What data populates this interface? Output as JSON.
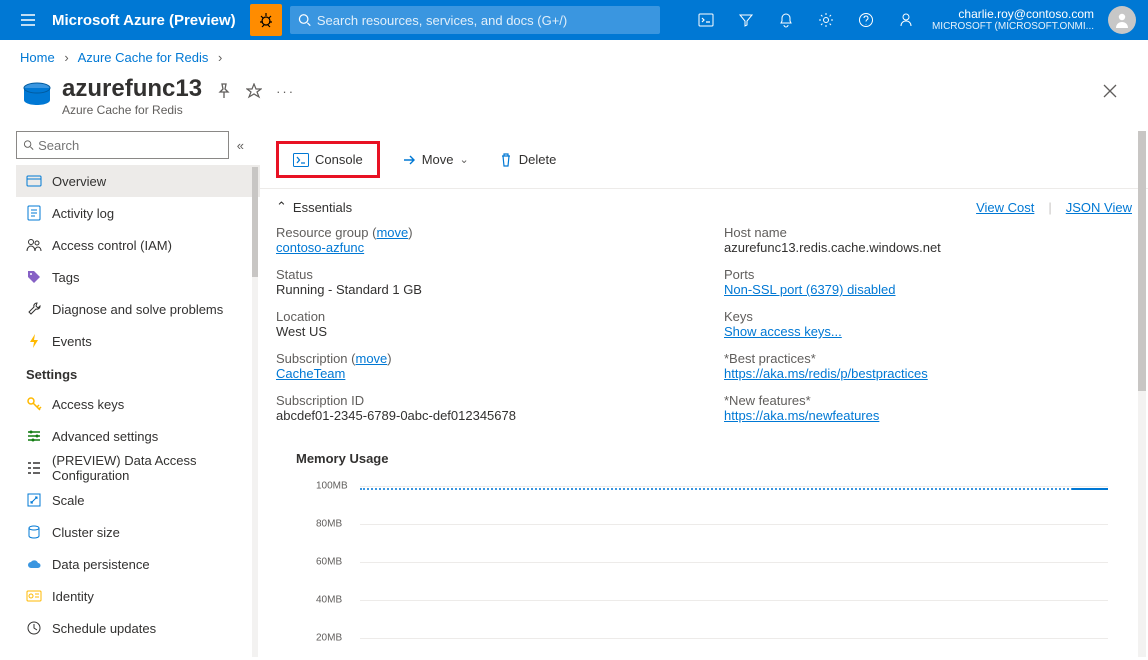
{
  "topbar": {
    "brand": "Microsoft Azure (Preview)",
    "search_placeholder": "Search resources, services, and docs (G+/)",
    "email": "charlie.roy@contoso.com",
    "org": "MICROSOFT (MICROSOFT.ONMI..."
  },
  "breadcrumb": {
    "items": [
      "Home",
      "Azure Cache for Redis"
    ]
  },
  "resource": {
    "name": "azurefunc13",
    "type": "Azure Cache for Redis"
  },
  "sidebar": {
    "search_placeholder": "Search",
    "items": [
      {
        "label": "Overview",
        "icon": "overview",
        "color": "#0078d4",
        "selected": true
      },
      {
        "label": "Activity log",
        "icon": "log",
        "color": "#0078d4"
      },
      {
        "label": "Access control (IAM)",
        "icon": "people",
        "color": "#323130"
      },
      {
        "label": "Tags",
        "icon": "tag",
        "color": "#8661c5"
      },
      {
        "label": "Diagnose and solve problems",
        "icon": "wrench",
        "color": "#323130"
      },
      {
        "label": "Events",
        "icon": "bolt",
        "color": "#ffb900"
      }
    ],
    "section": "Settings",
    "settings": [
      {
        "label": "Access keys",
        "icon": "key",
        "color": "#ffb900"
      },
      {
        "label": "Advanced settings",
        "icon": "sliders",
        "color": "#107c10"
      },
      {
        "label": "(PREVIEW) Data Access Configuration",
        "icon": "list",
        "color": "#323130"
      },
      {
        "label": "Scale",
        "icon": "scale",
        "color": "#0078d4"
      },
      {
        "label": "Cluster size",
        "icon": "cluster",
        "color": "#0078d4"
      },
      {
        "label": "Data persistence",
        "icon": "cloud",
        "color": "#3a96e0"
      },
      {
        "label": "Identity",
        "icon": "id",
        "color": "#ffb900"
      },
      {
        "label": "Schedule updates",
        "icon": "schedule",
        "color": "#323130"
      }
    ]
  },
  "toolbar": {
    "console": "Console",
    "move": "Move",
    "delete": "Delete"
  },
  "essentials": {
    "label": "Essentials",
    "view_cost": "View Cost",
    "json_view": "JSON View",
    "left": [
      {
        "k": "Resource group (",
        "klink": "move",
        "kend": ")",
        "vlink": "contoso-azfunc"
      },
      {
        "k": "Status",
        "v": "Running - Standard 1 GB"
      },
      {
        "k": "Location",
        "v": "West US"
      },
      {
        "k": "Subscription (",
        "klink": "move",
        "kend": ")",
        "vlink": "CacheTeam"
      },
      {
        "k": "Subscription ID",
        "v": "abcdef01-2345-6789-0abc-def012345678"
      }
    ],
    "right": [
      {
        "k": "Host name",
        "v": "azurefunc13.redis.cache.windows.net"
      },
      {
        "k": "Ports",
        "vlink": "Non-SSL port (6379) disabled"
      },
      {
        "k": "Keys",
        "vlink": "Show access keys..."
      },
      {
        "k": "*Best practices*",
        "vlink": "https://aka.ms/redis/p/bestpractices"
      },
      {
        "k": "*New features*",
        "vlink": "https://aka.ms/newfeatures"
      }
    ]
  },
  "chart_data": {
    "type": "line",
    "title": "Memory Usage",
    "ylabel": "",
    "ylim": [
      0,
      100
    ],
    "yticks": [
      "20MB",
      "40MB",
      "60MB",
      "80MB",
      "100MB"
    ],
    "series": [
      {
        "name": "memory",
        "approx_value": 100,
        "note": "flat line near 100MB across full range"
      }
    ]
  }
}
